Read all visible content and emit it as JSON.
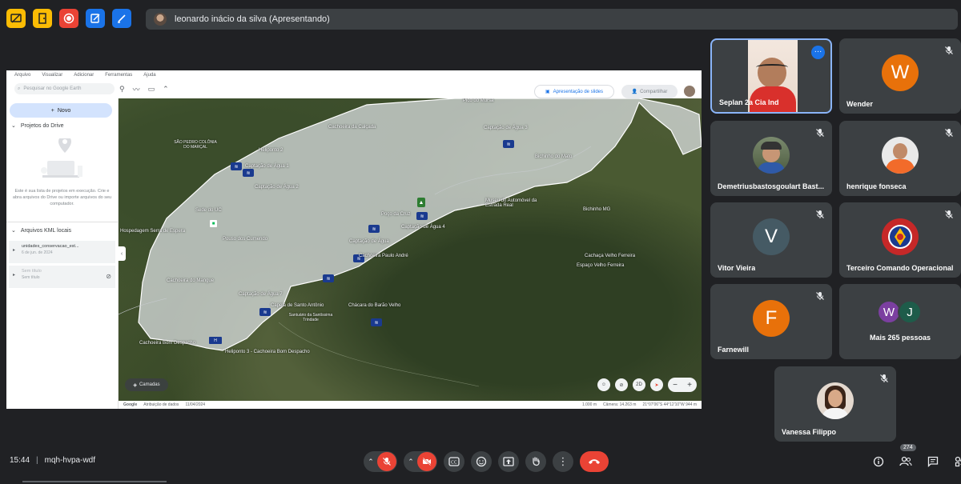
{
  "presenter": {
    "name": "leonardo inácio da silva (Apresentando)"
  },
  "earth": {
    "menu": [
      "Arquivo",
      "Visualizar",
      "Adicionar",
      "Ferramentas",
      "Ajuda"
    ],
    "search_placeholder": "Pesquisar no Google Earth",
    "slides_button": "Apresentação de slides",
    "share_button": "Compartilhar",
    "new_button": "Novo",
    "drive_projects": "Projetos do Drive",
    "drive_empty_text": "Este é sua lista de projetos em execução. Crie e abra arquivos do Drive ou importe arquivos do seu computador.",
    "kml_section": "Arquivos KML locais",
    "kml_items": [
      {
        "name": "unidades_conservacao_est...",
        "date": "6 de jun. de 2024"
      },
      {
        "name": "Sem título",
        "date": "Sem título"
      }
    ],
    "layers_button": "Camadas",
    "map_labels": [
      "Pico do Mursa",
      "Cachoeira da Calçada",
      "Captação de Água 3",
      "Heliponto 2",
      "Captação de Água 1",
      "Captação de Água 2",
      "SÃO PEDRO COLÔNIA DO MARÇAL",
      "Bichinho do Mato",
      "Poço da Cruz",
      "Captação de Água 4",
      "Museu do Automóvel da Estrada Real",
      "Bichinho MG",
      "Sede do UC",
      "Hospedagem Serra de Espera",
      "Pouso dos Cumendo",
      "Captação de Água",
      "Cachoeira Paulo André",
      "Cachaça Velho Ferreira",
      "Espaço Velho Ferreira",
      "Cachoeira do Mangue",
      "Captação de Água 7",
      "Capela de Santo Antônio",
      "Santuário da Santíssima Trindade",
      "Cachoeira Bom Despacho",
      "Heliponto 3 - Cachoeira Bom Despacho",
      "Chácara do Barão Velho"
    ],
    "map_controls": [
      "2D",
      "−",
      "+"
    ],
    "footer": {
      "google": "Google",
      "imagery": "Atribuição de dados",
      "date": "11/04/2024",
      "scale": "1.000 m",
      "camera": "Câmera: 14.263 m",
      "coords": "21°07'06\"S 44°12'10\"W 944 m"
    }
  },
  "participants": [
    {
      "name": "Seplan 2a Cia Ind",
      "type": "video"
    },
    {
      "name": "Wender",
      "initial": "W",
      "color": "#e8710a"
    },
    {
      "name": "Demetriusbastosgoulart Bast...",
      "type": "photo"
    },
    {
      "name": "henrique fonseca",
      "type": "photo"
    },
    {
      "name": "Vitor Vieira",
      "initial": "V",
      "color": "#455a64"
    },
    {
      "name": "Terceiro Comando Operacional",
      "type": "logo"
    },
    {
      "name": "Farnewill",
      "initial": "F",
      "color": "#e8710a"
    },
    {
      "name": "Mais 265 pessoas",
      "initials": [
        "W",
        "J"
      ],
      "colors": [
        "#7b3fa0",
        "#1e5c4a"
      ]
    },
    {
      "name": "Vanessa Filippo",
      "type": "photo"
    }
  ],
  "bottom": {
    "time": "15:44",
    "separator": "|",
    "meeting_code": "mqh-hvpa-wdf",
    "people_count": "274"
  }
}
